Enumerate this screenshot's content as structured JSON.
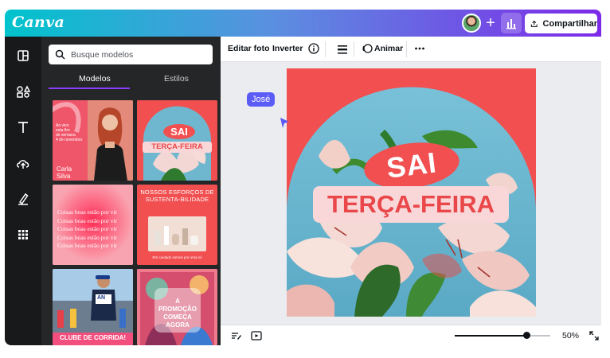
{
  "app": {
    "logo": "Canva"
  },
  "header": {
    "share_label": "Compartilhar"
  },
  "sidebar": {
    "icons": [
      "layout-icon",
      "elements-icon",
      "text-icon",
      "upload-cloud-icon",
      "draw-icon",
      "apps-grid-icon"
    ]
  },
  "panel": {
    "search_placeholder": "Busque modelos",
    "tabs": [
      {
        "label": "Modelos",
        "active": true
      },
      {
        "label": "Estilos",
        "active": false
      }
    ],
    "templates": [
      {
        "lines": [
          "Ao vivo",
          "esta fim",
          "de semana",
          "4 de novembro"
        ],
        "name": "Carla Silva"
      },
      {
        "top": "SAI",
        "bottom": "TERÇA-FEIRA"
      },
      {
        "lines": [
          "Coisas boas estão por vir",
          "Coisas boas estão por vir",
          "Coisas boas estão por vir",
          "Coisas boas estão por vir",
          "Coisas boas estão por vir"
        ]
      },
      {
        "heading": "NOSSOS ESFORÇOS DE SUSTENTA-BILIDADE",
        "footer": "Em cuidado somos por uma só"
      },
      {
        "caption": "CLUBE DE CORRIDA!",
        "bib": "AN"
      },
      {
        "text": "A PROMOÇÃO COMEÇA AGORA"
      }
    ]
  },
  "toolbar": {
    "edit_photo": "Editar foto",
    "flip": "Inverter",
    "animate": "Animar"
  },
  "canvas": {
    "collaborator": "José",
    "design_top": "SAI",
    "design_bottom": "TERÇA-FEIRA"
  },
  "footer": {
    "zoom": "50%",
    "zoom_level": 0.5
  },
  "colors": {
    "accent": "#8b3dff",
    "design_red": "#f24f50",
    "collab_tag": "#5b5cf6"
  }
}
